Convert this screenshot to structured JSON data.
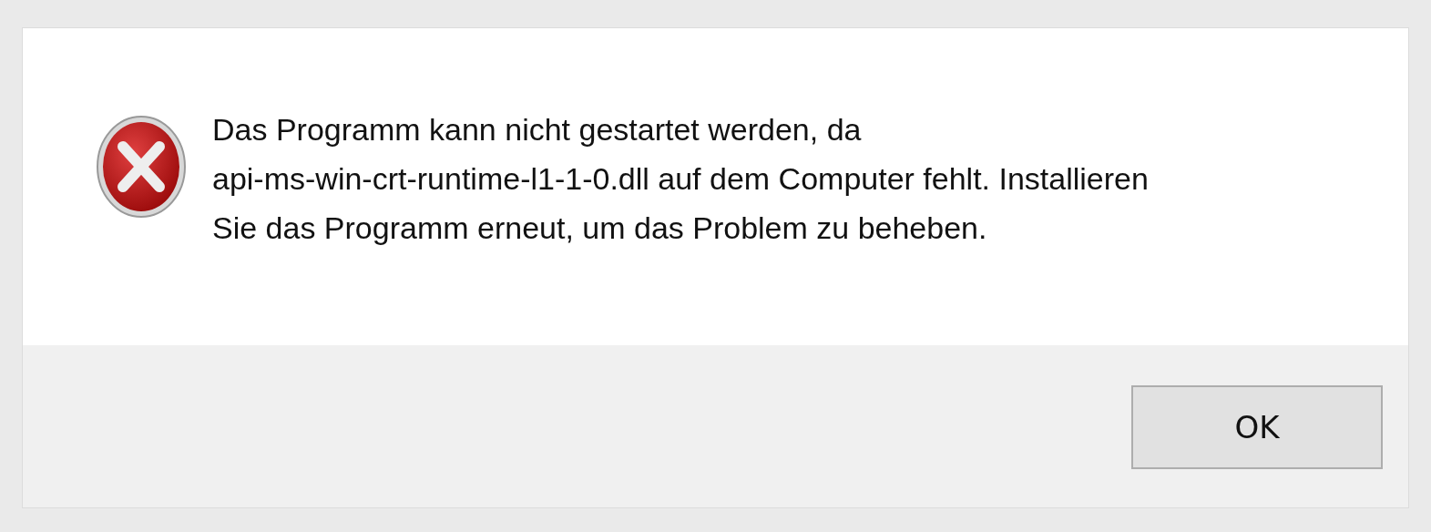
{
  "dialog": {
    "kind": "error",
    "message": "Das Programm kann nicht gestartet werden, da\napi-ms-win-crt-runtime-l1-1-0.dll auf dem Computer fehlt. Installieren\nSie das Programm erneut, um das Problem zu beheben.",
    "buttons": [
      {
        "label": "OK"
      }
    ]
  }
}
